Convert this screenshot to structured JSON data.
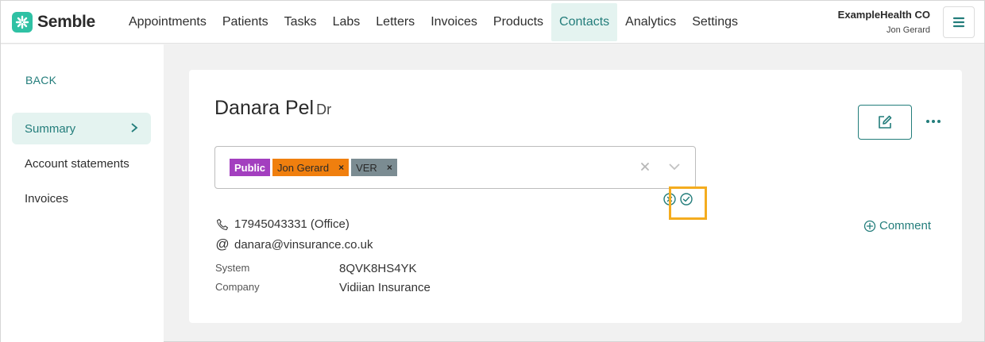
{
  "brand": {
    "name": "Semble",
    "color": "#2fc1a4"
  },
  "nav": {
    "items": [
      "Appointments",
      "Patients",
      "Tasks",
      "Labs",
      "Letters",
      "Invoices",
      "Products",
      "Contacts",
      "Analytics",
      "Settings"
    ],
    "active": "Contacts"
  },
  "account": {
    "org": "ExampleHealth CO",
    "user": "Jon Gerard"
  },
  "sidebar": {
    "back": "BACK",
    "items": [
      "Summary",
      "Account statements",
      "Invoices"
    ],
    "active": "Summary"
  },
  "contact": {
    "name": "Danara Pel",
    "title": "Dr",
    "tags": [
      {
        "label": "Public",
        "color": "#a33fbf",
        "removable": false
      },
      {
        "label": "Jon Gerard",
        "color": "#f07f0e",
        "removable": true
      },
      {
        "label": "VER",
        "color": "#7b8c92",
        "removable": true
      }
    ],
    "phone": "17945043331 (Office)",
    "email": "danara@vinsurance.co.uk",
    "fields": [
      {
        "label": "System",
        "value": "8QVK8HS4YK"
      },
      {
        "label": "Company",
        "value": "Vidiian Insurance"
      }
    ],
    "comment_label": "Comment"
  },
  "colors": {
    "accent": "#237d7b",
    "highlight": "#f4ac1f"
  },
  "icons": [
    "logo-icon",
    "menu-icon",
    "chevron-right-icon",
    "edit-icon",
    "more-icon",
    "clear-icon",
    "chevron-down-icon",
    "cancel-icon",
    "check-icon",
    "phone-icon",
    "at-icon",
    "add-circle-icon"
  ]
}
